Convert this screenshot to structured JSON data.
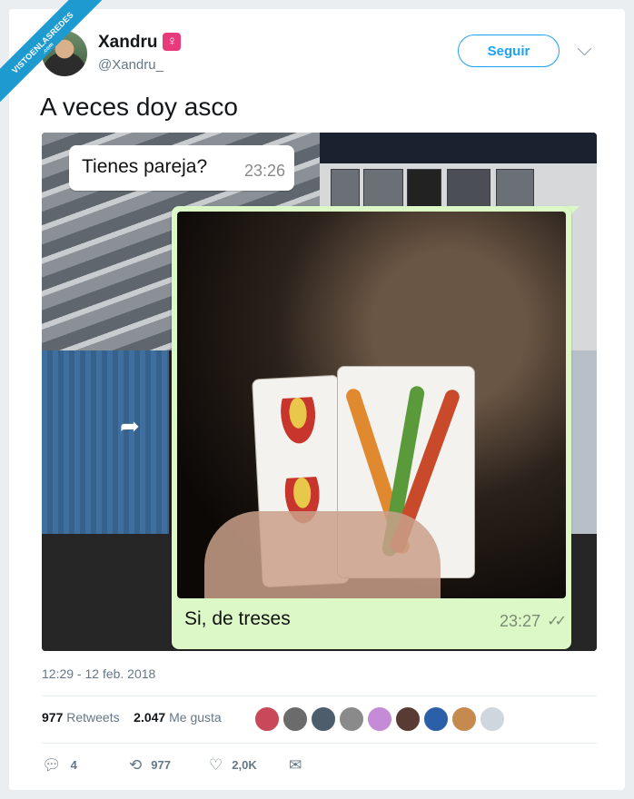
{
  "ribbon": {
    "text": "VISTOENLASREDES",
    "sub": ".com"
  },
  "user": {
    "name": "Xandru",
    "gender_symbol": "♀",
    "handle": "@Xandru_"
  },
  "follow_label": "Seguir",
  "tweet_text": "A veces doy asco",
  "chat": {
    "incoming": {
      "text": "Tienes pareja?",
      "time": "23:26"
    },
    "outgoing": {
      "text": "Si, de treses",
      "time": "23:27",
      "ticks": "✓✓"
    }
  },
  "timestamp": "12:29 - 12 feb. 2018",
  "stats": {
    "retweets_count": "977",
    "retweets_label": "Retweets",
    "likes_count": "2.047",
    "likes_label": "Me gusta"
  },
  "liker_colors": [
    "#c9485a",
    "#6b6b6b",
    "#4e5d6b",
    "#8a8a8a",
    "#c58bd6",
    "#5a3b34",
    "#2b5fa8",
    "#c78a4e",
    "#cfd6de"
  ],
  "actions": {
    "reply": {
      "icon": "reply-icon",
      "count": "4"
    },
    "retweet": {
      "icon": "retweet-icon",
      "count": "977"
    },
    "like": {
      "icon": "heart-icon",
      "count": "2,0K"
    },
    "message": {
      "icon": "envelope-icon"
    }
  },
  "colors": {
    "accent": "#1da1f2",
    "chat_out": "#dcf8c6",
    "gender_badge": "#e8397a"
  }
}
